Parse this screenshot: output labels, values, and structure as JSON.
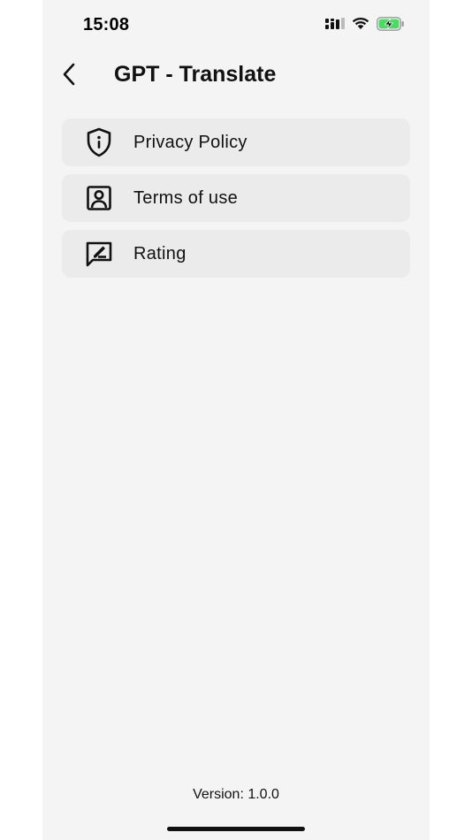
{
  "status_bar": {
    "time": "15:08",
    "icons": [
      "cellular-signal-icon",
      "wifi-icon",
      "battery-charging-icon"
    ],
    "battery_color": "#4cd964"
  },
  "header": {
    "back_icon": "chevron-left-icon",
    "title": "GPT - Translate"
  },
  "menu": {
    "items": [
      {
        "label": "Privacy Policy",
        "icon": "shield-info-icon"
      },
      {
        "label": "Terms of use",
        "icon": "user-badge-icon"
      },
      {
        "label": "Rating",
        "icon": "feedback-edit-icon"
      }
    ]
  },
  "footer": {
    "version": "Version: 1.0.0"
  },
  "colors": {
    "background": "#f4f4f4",
    "item_background": "#ebebeb",
    "text": "#111111"
  }
}
